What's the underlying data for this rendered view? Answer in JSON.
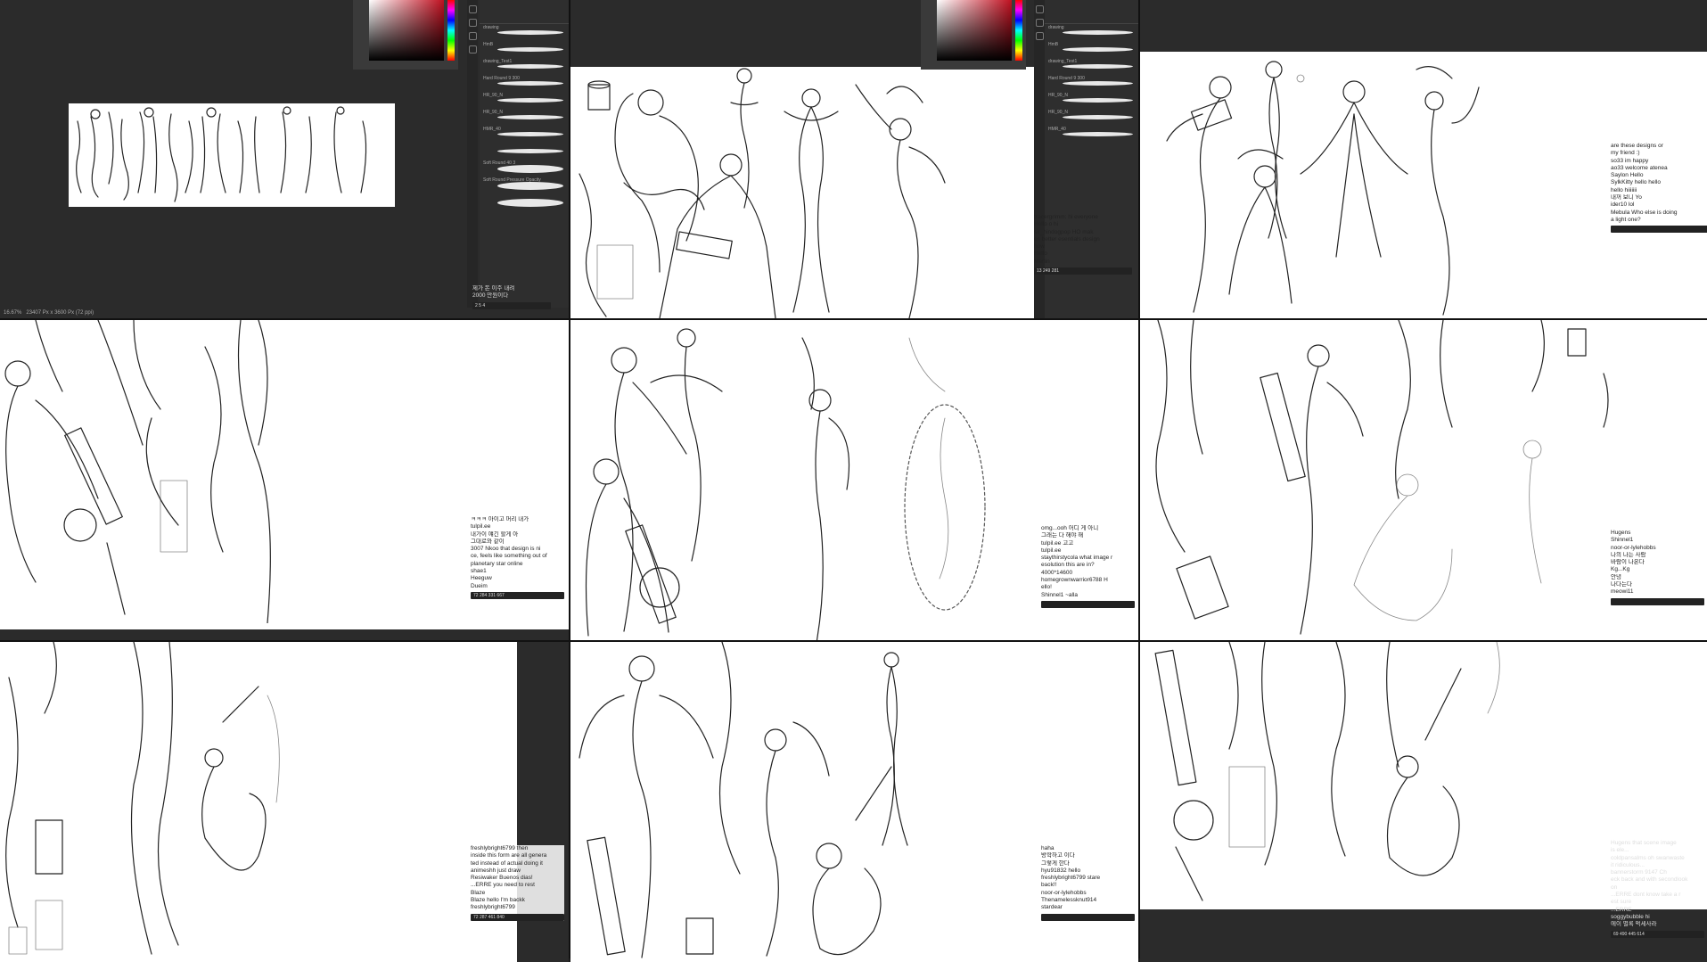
{
  "window": {
    "title": ""
  },
  "statusbar": {
    "zoom": "16.67%",
    "doc": "23407 Px x 3600 Px (72 ppi)"
  },
  "chats": [
    {
      "messages": [
        {
          "user": "",
          "text": "제가 돈 이주 내려"
        },
        {
          "user": "",
          "text": "2000 만원이다"
        }
      ],
      "stats": "2   5   4"
    },
    {
      "messages": [
        {
          "user": "",
          "text": "tracergrimm: hi everyone"
        },
        {
          "user": "",
          "text": "Hello o hi"
        },
        {
          "user": "",
          "text": "sir_hindogpop HO mak"
        },
        {
          "user": "",
          "text": "es better esentials design"
        },
        {
          "user": "",
          "text": "how"
        },
        {
          "user": "",
          "text": "Hello"
        },
        {
          "user": "",
          "text": "Merlin"
        }
      ],
      "stats": "13   249   281"
    },
    {
      "messages": [
        {
          "user": "",
          "text": "are these designs or"
        },
        {
          "user": "",
          "text": "my friend :)"
        },
        {
          "user": "",
          "text": "so33  im happy"
        },
        {
          "user": "",
          "text": "ao33  welcome atenea"
        },
        {
          "user": "",
          "text": "Saylon  Hello"
        },
        {
          "user": "",
          "text": "SylkKitty  hello hello"
        },
        {
          "user": "",
          "text": "hello hiiiiiii"
        },
        {
          "user": "",
          "text": "내꺼 보니 Yo"
        },
        {
          "user": "",
          "text": "ider10  lol"
        },
        {
          "user": "",
          "text": "Mebula  Who else is doing"
        },
        {
          "user": "",
          "text": "a light one?"
        }
      ],
      "stats": ""
    },
    {
      "messages": [
        {
          "user": "",
          "text": "ㅋㅋㅋ 아이고 머리 내가"
        },
        {
          "user": "",
          "text": "tulpil.ee"
        },
        {
          "user": "",
          "text": "내가이 얘긴 할게 아"
        },
        {
          "user": "",
          "text": "그대로와 같이"
        },
        {
          "user": "",
          "text": "3007 Nkoo  that design is ni"
        },
        {
          "user": "",
          "text": "ce, feels like something out of"
        },
        {
          "user": "",
          "text": "planetary star online"
        },
        {
          "user": "",
          "text": "shae1"
        },
        {
          "user": "",
          "text": "Heeguw"
        },
        {
          "user": "",
          "text": "Dueim"
        }
      ],
      "stats": "72   284   331   667"
    },
    {
      "messages": [
        {
          "user": "",
          "text": "omg...ooh 어디 게 아니"
        },
        {
          "user": "",
          "text": "그래는 다 해야 해"
        },
        {
          "user": "",
          "text": "tulpil.ee  고고"
        },
        {
          "user": "",
          "text": "tulpil.ee"
        },
        {
          "user": "",
          "text": "staythirstycola  what image r"
        },
        {
          "user": "",
          "text": "esolution this are in?"
        },
        {
          "user": "",
          "text": "4000*14600"
        },
        {
          "user": "",
          "text": "homegrownwarrior6788 H"
        },
        {
          "user": "",
          "text": "ello!"
        },
        {
          "user": "",
          "text": "Shinnel1 ~alla"
        }
      ],
      "stats": ""
    },
    {
      "messages": [
        {
          "user": "",
          "text": "Hugens"
        },
        {
          "user": "",
          "text": "Shinnel1"
        },
        {
          "user": "",
          "text": "noor-or-lylehobbs"
        },
        {
          "user": "",
          "text": "나의 나는 사람"
        },
        {
          "user": "",
          "text": "바람이 나온다"
        },
        {
          "user": "",
          "text": "Kg...Kg"
        },
        {
          "user": "",
          "text": "안녕"
        },
        {
          "user": "",
          "text": "나다는다"
        },
        {
          "user": "",
          "text": "meowi11"
        }
      ],
      "stats": ""
    },
    {
      "messages": [
        {
          "user": "",
          "text": "freshlybright6799  then"
        },
        {
          "user": "",
          "text": "inside this form are all genera"
        },
        {
          "user": "",
          "text": "ted instead of actual doing it"
        },
        {
          "user": "",
          "text": "animeshh  just draw"
        },
        {
          "user": "",
          "text": "Resiwaker  Buenos dias!"
        },
        {
          "user": "",
          "text": "...ERRE  you need to rest"
        },
        {
          "user": "",
          "text": "Blaze"
        },
        {
          "user": "",
          "text": "Blaze  hello I'm backk"
        },
        {
          "user": "",
          "text": "freshlybright6799"
        }
      ],
      "stats": "72   287   461   840"
    },
    {
      "messages": [
        {
          "user": "",
          "text": "haha"
        },
        {
          "user": "",
          "text": "방학하고 이다"
        },
        {
          "user": "",
          "text": "그렇게 한다"
        },
        {
          "user": "",
          "text": "hyu91832  hello"
        },
        {
          "user": "",
          "text": "freshlybright6799  stare"
        },
        {
          "user": "",
          "text": "back!!"
        },
        {
          "user": "",
          "text": "noor-or-lylehobbs"
        },
        {
          "user": "",
          "text": "Thenamelessknut914"
        },
        {
          "user": "",
          "text": "stardear"
        }
      ],
      "stats": ""
    },
    {
      "messages": [
        {
          "user": "",
          "text": "Hugens  that scene image"
        },
        {
          "user": "",
          "text": "is ele..."
        },
        {
          "user": "",
          "text": "coldpansalms  oh swanwaste"
        },
        {
          "user": "",
          "text": "it ridiculous..."
        },
        {
          "user": "",
          "text": "bannerstorm  9147  Ch"
        },
        {
          "user": "",
          "text": "eck back and with secondlook"
        },
        {
          "user": "",
          "text": "on"
        },
        {
          "user": "",
          "text": "...ERRE  dont know take a r"
        },
        {
          "user": "",
          "text": "est sure"
        },
        {
          "user": "",
          "text": "...ERRE"
        },
        {
          "user": "",
          "text": "soggybubble  hi"
        },
        {
          "user": "",
          "text": "에이 별록 먹세사라"
        }
      ],
      "stats": "69   490   445   614"
    }
  ],
  "brushes": [
    "drawing",
    "HmB",
    "drawing_Test1",
    "Hard Round 9 300",
    "HR_90_N",
    "HR_90_N",
    "HMR_40",
    "",
    "Soft Round 40 3",
    "Soft Round Pressure Opacity",
    ""
  ]
}
